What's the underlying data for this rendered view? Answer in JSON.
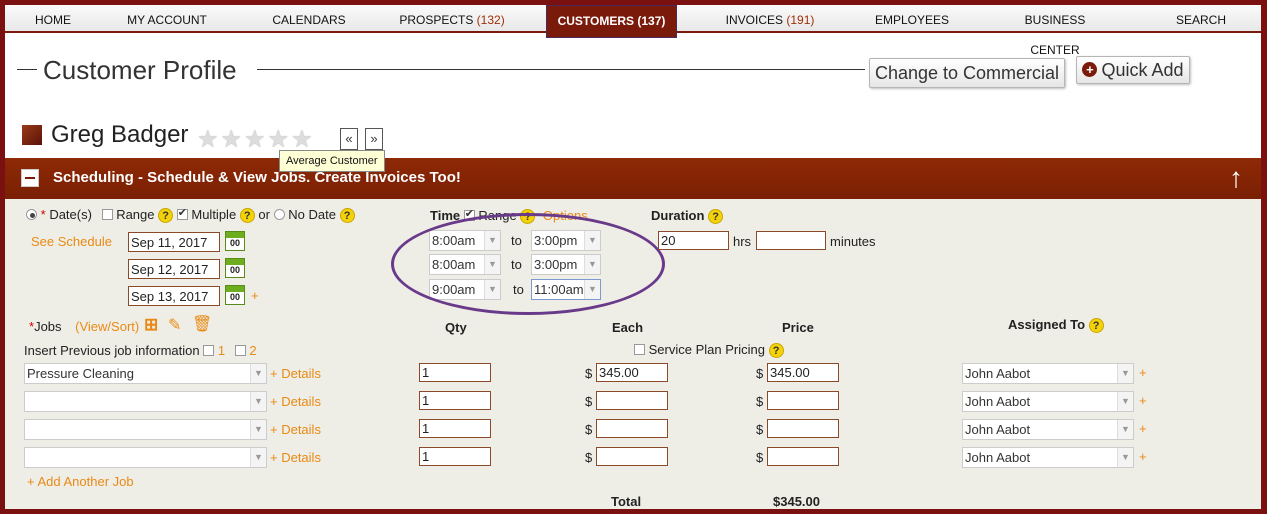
{
  "nav": {
    "home": "HOME",
    "account": "MY ACCOUNT",
    "calendars": "CALENDARS",
    "prospects": "PROSPECTS",
    "prospects_count": "(132)",
    "customers": "CUSTOMERS",
    "customers_count": "(137)",
    "invoices": "INVOICES",
    "invoices_count": "(191)",
    "employees": "EMPLOYEES",
    "business": "BUSINESS CENTER",
    "search": "SEARCH"
  },
  "page": {
    "title": "Customer Profile",
    "change_btn": "Change to Commercial",
    "quick_add": "Quick Add"
  },
  "customer": {
    "name": "Greg Badger",
    "rating_stars": 0,
    "tooltip": "Average Customer",
    "prev": "«",
    "next": "»"
  },
  "section": {
    "title": "Scheduling - Schedule & View Jobs. Create Invoices Too!"
  },
  "dates": {
    "label": "Date(s)",
    "required": "*",
    "range": "Range",
    "multiple": "Multiple",
    "or": "or",
    "no_date": "No Date",
    "see_schedule": "See Schedule",
    "values": [
      "Sep 11, 2017",
      "Sep 12, 2017",
      "Sep 13, 2017"
    ],
    "cal_text": "00",
    "add": "+"
  },
  "time": {
    "label": "Time",
    "range": "Range",
    "options": "Options",
    "to": "to",
    "rows": [
      {
        "from": "8:00am",
        "to": "3:00pm"
      },
      {
        "from": "8:00am",
        "to": "3:00pm"
      },
      {
        "from": "9:00am",
        "to": "11:00am"
      }
    ]
  },
  "duration": {
    "label": "Duration",
    "hrs_value": "20",
    "hrs": "hrs",
    "minutes_value": "",
    "minutes": "minutes"
  },
  "jobs": {
    "required": "*",
    "label": "Jobs",
    "view_sort": "(View/Sort)",
    "insert_prev": "Insert Previous job information",
    "opt1": "1",
    "opt2": "2",
    "qty_hdr": "Qty",
    "each_hdr": "Each",
    "price_hdr": "Price",
    "assigned_hdr": "Assigned To",
    "service_plan": "Service Plan Pricing",
    "details": "+ Details",
    "currency": "$",
    "assign_add": "+",
    "rows": [
      {
        "job": "Pressure Cleaning",
        "qty": "1",
        "each": "345.00",
        "price": "345.00",
        "assigned": "John Aabot"
      },
      {
        "job": "",
        "qty": "1",
        "each": "",
        "price": "",
        "assigned": "John Aabot"
      },
      {
        "job": "",
        "qty": "1",
        "each": "",
        "price": "",
        "assigned": "John Aabot"
      },
      {
        "job": "",
        "qty": "1",
        "each": "",
        "price": "",
        "assigned": "John Aabot"
      }
    ],
    "add_another": "+ Add Another Job",
    "total_label": "Total",
    "total_value": "$345.00"
  },
  "help_glyph": "?",
  "colors": {
    "brand": "#7a1a0a",
    "accent": "#ea8a16",
    "help": "#f4d20a",
    "highlight": "#6a3a8a"
  }
}
